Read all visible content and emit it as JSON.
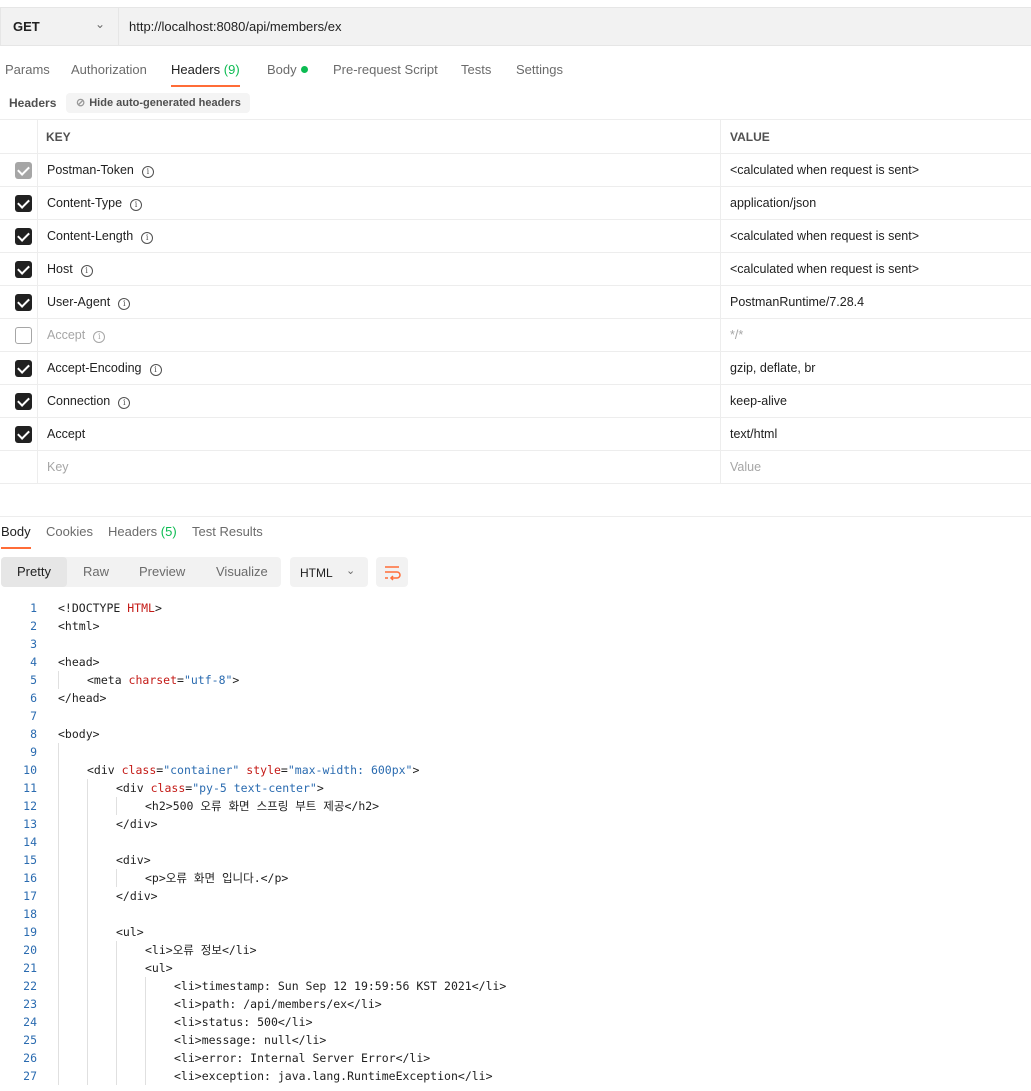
{
  "request": {
    "method": "GET",
    "url": "http://localhost:8080/api/members/ex"
  },
  "request_tabs": [
    {
      "label": "Params"
    },
    {
      "label": "Authorization"
    },
    {
      "label": "Headers",
      "count": "(9)"
    },
    {
      "label": "Body"
    },
    {
      "label": "Pre-request Script"
    },
    {
      "label": "Tests"
    },
    {
      "label": "Settings"
    }
  ],
  "headers_section": {
    "title": "Headers",
    "hide_button": "Hide auto-generated headers"
  },
  "table": {
    "key_header": "KEY",
    "value_header": "VALUE",
    "rows": [
      {
        "key": "Postman-Token",
        "value": "<calculated when request is sent>",
        "state": "locked"
      },
      {
        "key": "Content-Type",
        "value": "application/json",
        "state": "checked"
      },
      {
        "key": "Content-Length",
        "value": "<calculated when request is sent>",
        "state": "checked"
      },
      {
        "key": "Host",
        "value": "<calculated when request is sent>",
        "state": "checked"
      },
      {
        "key": "User-Agent",
        "value": "PostmanRuntime/7.28.4",
        "state": "checked"
      },
      {
        "key": "Accept",
        "value": "*/*",
        "state": "unchecked"
      },
      {
        "key": "Accept-Encoding",
        "value": "gzip, deflate, br",
        "state": "checked"
      },
      {
        "key": "Connection",
        "value": "keep-alive",
        "state": "checked"
      },
      {
        "key": "Accept",
        "value": "text/html",
        "state": "checked"
      }
    ],
    "new_key_placeholder": "Key",
    "new_value_placeholder": "Value"
  },
  "response_tabs": [
    {
      "label": "Body"
    },
    {
      "label": "Cookies"
    },
    {
      "label": "Headers",
      "count": "(5)"
    },
    {
      "label": "Test Results"
    }
  ],
  "view_modes": [
    "Pretty",
    "Raw",
    "Preview",
    "Visualize"
  ],
  "format": "HTML",
  "code_lines": [
    "1",
    "2",
    "3",
    "4",
    "5",
    "6",
    "7",
    "8",
    "9",
    "10",
    "11",
    "12",
    "13",
    "14",
    "15",
    "16",
    "17",
    "18",
    "19",
    "20",
    "21",
    "22",
    "23",
    "24",
    "25",
    "26",
    "27"
  ],
  "code": {
    "l1_a": "<!DOCTYPE ",
    "l1_b": "HTML",
    "l1_c": ">",
    "l2": "<html>",
    "l4": "<head>",
    "l5_a": "<meta ",
    "l5_b": "charset",
    "l5_c": "=",
    "l5_d": "\"utf-8\"",
    "l5_e": ">",
    "l6": "</head>",
    "l8": "<body>",
    "l10_a": "<div ",
    "l10_b": "class",
    "l10_c": "=",
    "l10_d": "\"container\"",
    "l10_e": " ",
    "l10_f": "style",
    "l10_g": "=",
    "l10_h": "\"max-width: 600px\"",
    "l10_i": ">",
    "l11_a": "<div ",
    "l11_b": "class",
    "l11_c": "=",
    "l11_d": "\"py-5 text-center\"",
    "l11_e": ">",
    "l12_a": "<h2>",
    "l12_b": "500 오류 화면 스프링 부트 제공",
    "l12_c": "</h2>",
    "l13": "</div>",
    "l15": "<div>",
    "l16_a": "<p>",
    "l16_b": "오류 화면 입니다.",
    "l16_c": "</p>",
    "l17": "</div>",
    "l19": "<ul>",
    "l20_a": "<li>",
    "l20_b": "오류 정보",
    "l20_c": "</li>",
    "l21": "<ul>",
    "l22_a": "<li>",
    "l22_b": "timestamp: Sun Sep 12 19:59:56 KST 2021",
    "l22_c": "</li>",
    "l23_a": "<li>",
    "l23_b": "path: /api/members/ex",
    "l23_c": "</li>",
    "l24_a": "<li>",
    "l24_b": "status: 500",
    "l24_c": "</li>",
    "l25_a": "<li>",
    "l25_b": "message: null",
    "l25_c": "</li>",
    "l26_a": "<li>",
    "l26_b": "error: Internal Server Error",
    "l26_c": "</li>",
    "l27_a": "<li>",
    "l27_b": "exception: java.lang.RuntimeException",
    "l27_c": "</li>"
  }
}
